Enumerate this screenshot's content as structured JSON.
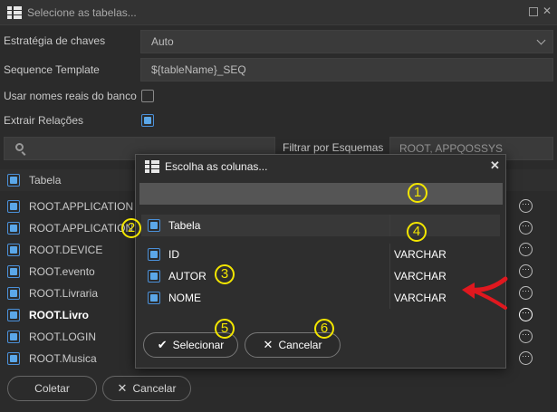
{
  "window": {
    "title": "Selecione as tabelas..."
  },
  "form": {
    "strategy_label": "Estratégia de chaves",
    "strategy_value": "Auto",
    "sequence_label": "Sequence Template",
    "sequence_value": "${tableName}_SEQ",
    "real_names_label": "Usar nomes reais do banco",
    "relations_label": "Extrair Relações",
    "filter_schema_label": "Filtrar por Esquemas",
    "filter_schema_value": "ROOT, APPQOSSYS"
  },
  "tables": {
    "header": "Tabela",
    "rows": [
      {
        "name": "ROOT.APPLICATION"
      },
      {
        "name": "ROOT.APPLICATION"
      },
      {
        "name": "ROOT.DEVICE"
      },
      {
        "name": "ROOT.evento"
      },
      {
        "name": "ROOT.Livraria"
      },
      {
        "name": "ROOT.Livro"
      },
      {
        "name": "ROOT.LOGIN"
      },
      {
        "name": "ROOT.Musica"
      }
    ]
  },
  "footer": {
    "collect_label": "Coletar",
    "cancel_label": "Cancelar"
  },
  "modal": {
    "title": "Escolha as colunas...",
    "header_col": "Tabela",
    "columns": [
      {
        "name": "ID",
        "type": "VARCHAR"
      },
      {
        "name": "AUTOR",
        "type": "VARCHAR"
      },
      {
        "name": "NOME",
        "type": "VARCHAR"
      }
    ],
    "select_label": "Selecionar",
    "cancel_label": "Cancelar"
  },
  "annotations": [
    "1",
    "2",
    "3",
    "4",
    "5",
    "6"
  ],
  "colors": {
    "accent": "#5ba7e8",
    "annotation": "#f3e600",
    "arrow": "#e0181f"
  },
  "icons": {
    "table": "table-icon",
    "search": "search-icon",
    "close": "close-icon",
    "more": "more-icon",
    "check": "check-icon"
  }
}
